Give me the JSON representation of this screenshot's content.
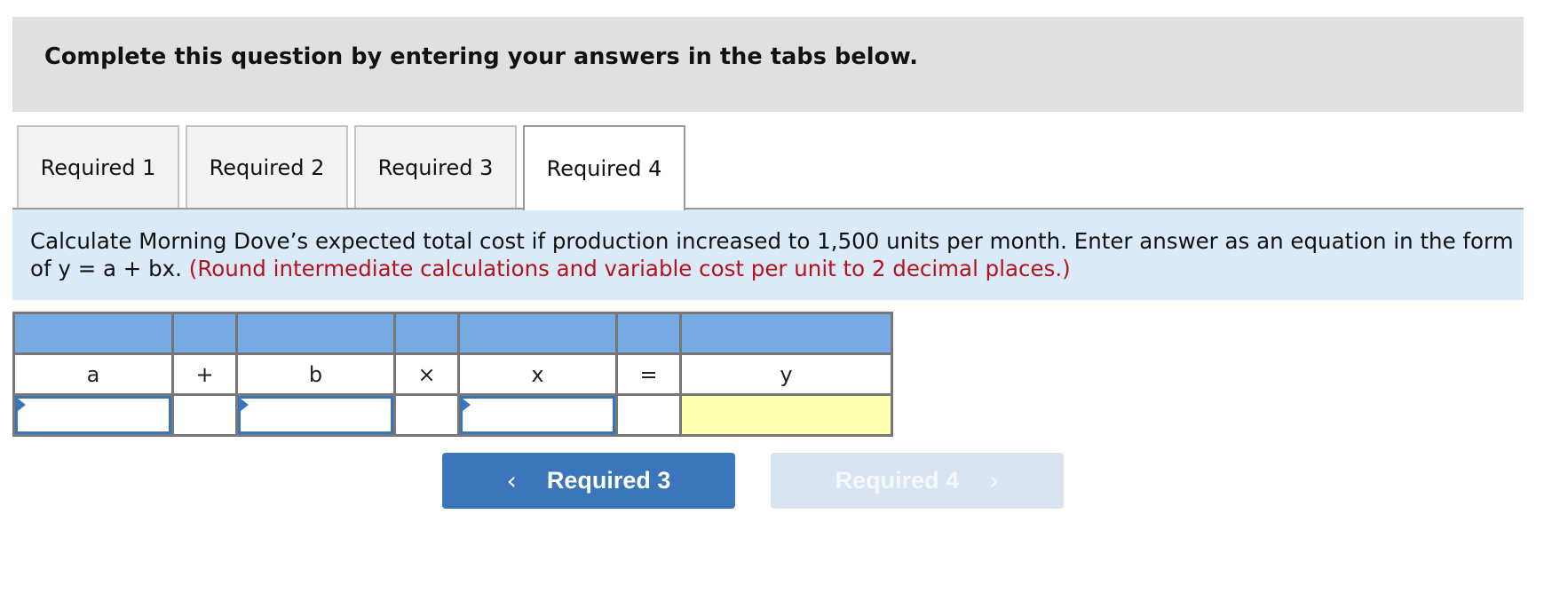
{
  "header": {
    "instruction": "Complete this question by entering your answers in the tabs below."
  },
  "tabs": [
    {
      "label": "Required 1",
      "active": false
    },
    {
      "label": "Required 2",
      "active": false
    },
    {
      "label": "Required 3",
      "active": false
    },
    {
      "label": "Required 4",
      "active": true
    }
  ],
  "question": {
    "text": "Calculate Morning Dove’s expected total cost if production increased to 1,500 units per month. Enter answer as an equation in the form of y = a + bx.",
    "note": "(Round intermediate calculations and variable cost per unit to 2 decimal places.)"
  },
  "equation_table": {
    "labels": [
      "a",
      "+",
      "b",
      "×",
      "x",
      "=",
      "y"
    ],
    "inputs": {
      "a": "",
      "b": "",
      "x": "",
      "y": ""
    }
  },
  "navigation": {
    "prev_label": "Required 3",
    "next_label": "Required 4",
    "prev_icon": "chevron-left-icon",
    "next_icon": "chevron-right-icon",
    "next_enabled": false
  },
  "colors": {
    "accent_blue": "#3a76b9",
    "table_header_blue": "#78abe3",
    "info_band": "#dbeaf8",
    "note_red": "#b5121b",
    "answer_cell_yellow": "#ffffad"
  }
}
